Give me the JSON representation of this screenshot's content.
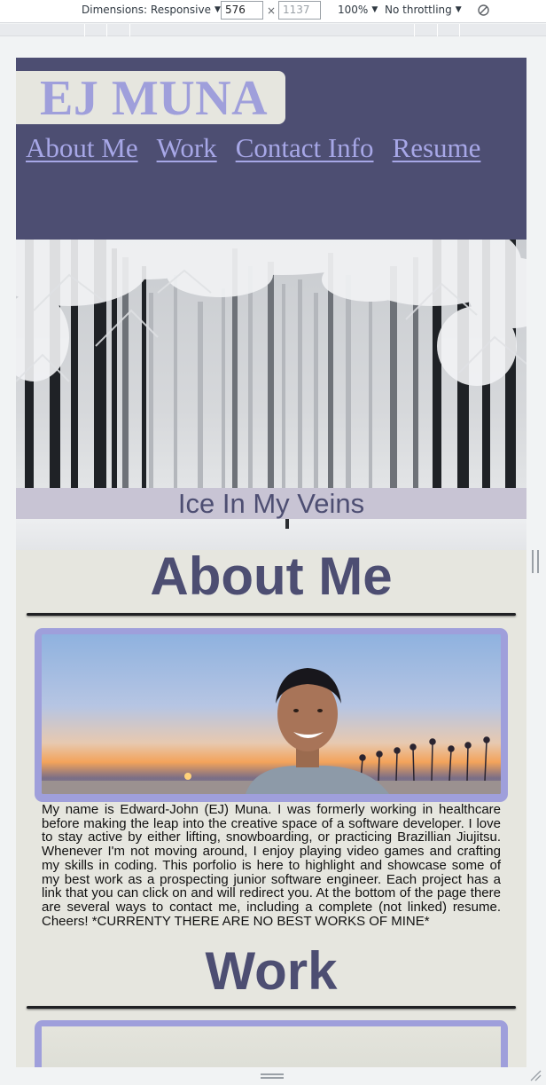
{
  "devtools": {
    "dimensions_label": "Dimensions: Responsive",
    "width_value": "576",
    "height_placeholder": "1137",
    "times": "×",
    "zoom": "100%",
    "throttling": "No throttling",
    "caret": "▼"
  },
  "site": {
    "logo": "EJ MUNA",
    "nav": [
      "About Me",
      "Work",
      "Contact Info",
      "Resume"
    ],
    "hero_caption": "Ice In My Veins",
    "about_title": "About Me",
    "about_text": "My name is Edward-John (EJ) Muna. I was formerly working in healthcare before making the leap into the creative space of a software developer. I love to stay active by either lifting, snowboarding, or practicing Brazillian Jiujitsu. Whenever I'm not moving around, I enjoy playing video games and crafting my skills in coding. This porfolio is here to highlight and showcase some of my best work as a prospecting junior software engineer. Each project has a link that you can click on and will redirect you. At the bottom of the page there are several ways to contact me, including a complete (not linked) resume. Cheers! *CURRENTY THERE ARE NO BEST WORKS OF MINE*",
    "work_title": "Work"
  },
  "colors": {
    "header_bg": "#4d4e72",
    "accent": "#9f9fdb",
    "page_bg": "#e6e6df"
  }
}
